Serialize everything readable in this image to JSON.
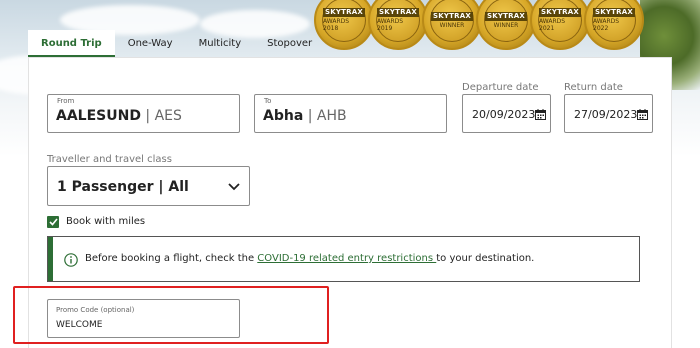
{
  "tabs": [
    "Round Trip",
    "One-Way",
    "Multicity",
    "Stopover"
  ],
  "medals": [
    {
      "band": "SKYTRAX",
      "year": "AWARDS 2018"
    },
    {
      "band": "SKYTRAX",
      "year": "AWARDS 2019"
    },
    {
      "band": "SKYTRAX",
      "year": "WINNER"
    },
    {
      "band": "SKYTRAX",
      "year": "WINNER"
    },
    {
      "band": "SKYTRAX",
      "year": "AWARDS 2021"
    },
    {
      "band": "SKYTRAX",
      "year": "AWARDS 2022"
    }
  ],
  "from": {
    "label": "From",
    "city": "AALESUND",
    "code": "AES"
  },
  "to": {
    "label": "To",
    "city": "Abha",
    "code": "AHB"
  },
  "departure": {
    "label": "Departure date",
    "value": "20/09/2023"
  },
  "return": {
    "label": "Return date",
    "value": "27/09/2023"
  },
  "traveller": {
    "label": "Traveller and travel class",
    "value": "1 Passenger | All"
  },
  "miles": {
    "label": "Book with miles",
    "checked": true
  },
  "notice": {
    "before": "Before booking a flight, check the ",
    "link": "COVID-19 related entry restrictions ",
    "after": "to your destination."
  },
  "promo": {
    "label": "Promo Code (optional)",
    "value": "WELCOME"
  },
  "colors": {
    "brand_green": "#2d6e35",
    "highlight_red": "#e02020",
    "medal_gold": "#d9a928"
  }
}
